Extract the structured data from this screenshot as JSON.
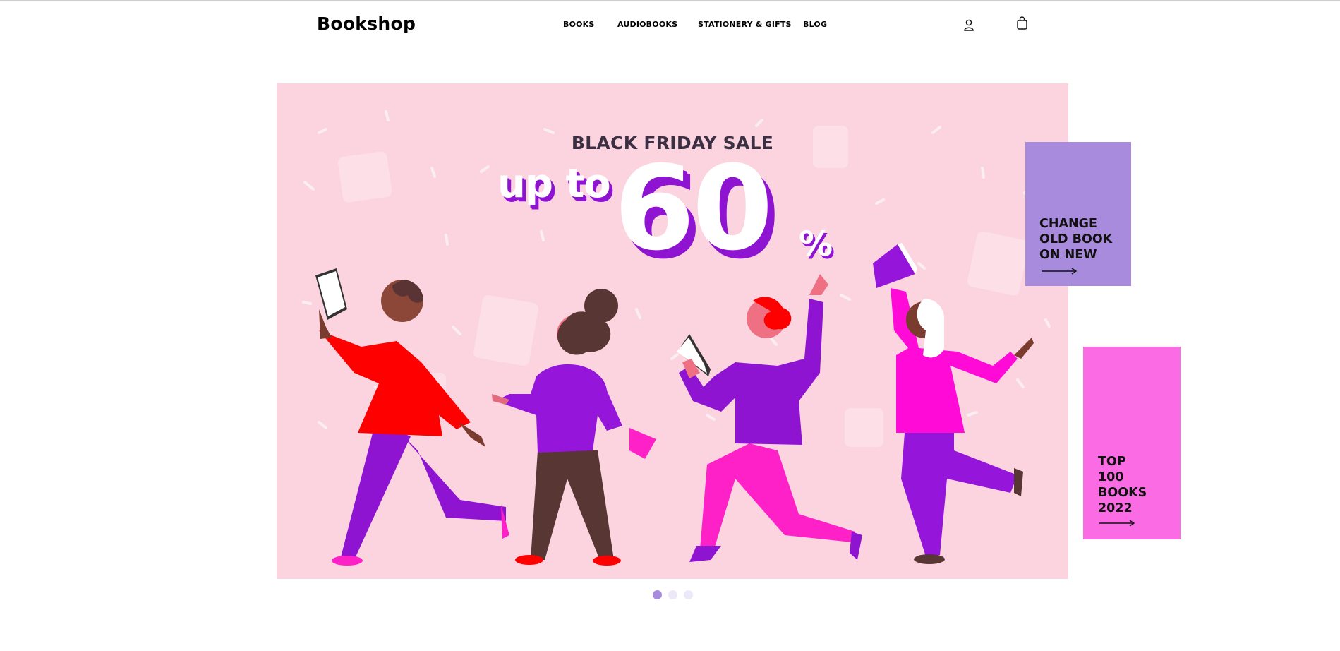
{
  "header": {
    "logo": "Bookshop",
    "nav": [
      {
        "label": "BOOKS"
      },
      {
        "label": "AUDIOBOOKS"
      },
      {
        "label": "STATIONERY & GIFTS"
      },
      {
        "label": "BLOG"
      }
    ],
    "icons": [
      "user-icon",
      "shopping-bag-icon"
    ]
  },
  "hero": {
    "subtitle": "BLACK FRIDAY SALE",
    "prefix": "up to",
    "number": "60",
    "suffix": "%",
    "background_color": "#fcd4df",
    "accent_color": "#8e14d1"
  },
  "promos": [
    {
      "label": "CHANGE\nOLD BOOK\nON NEW",
      "color": "#a98bde",
      "icon": "arrow-right-icon"
    },
    {
      "label": "TOP\n100\nBOOKS\n2022",
      "color": "#fb6be4",
      "icon": "arrow-right-icon"
    }
  ],
  "carousel": {
    "slides": 3,
    "active_index": 0,
    "active_color": "#a98bde",
    "inactive_color": "#ece8f7"
  }
}
